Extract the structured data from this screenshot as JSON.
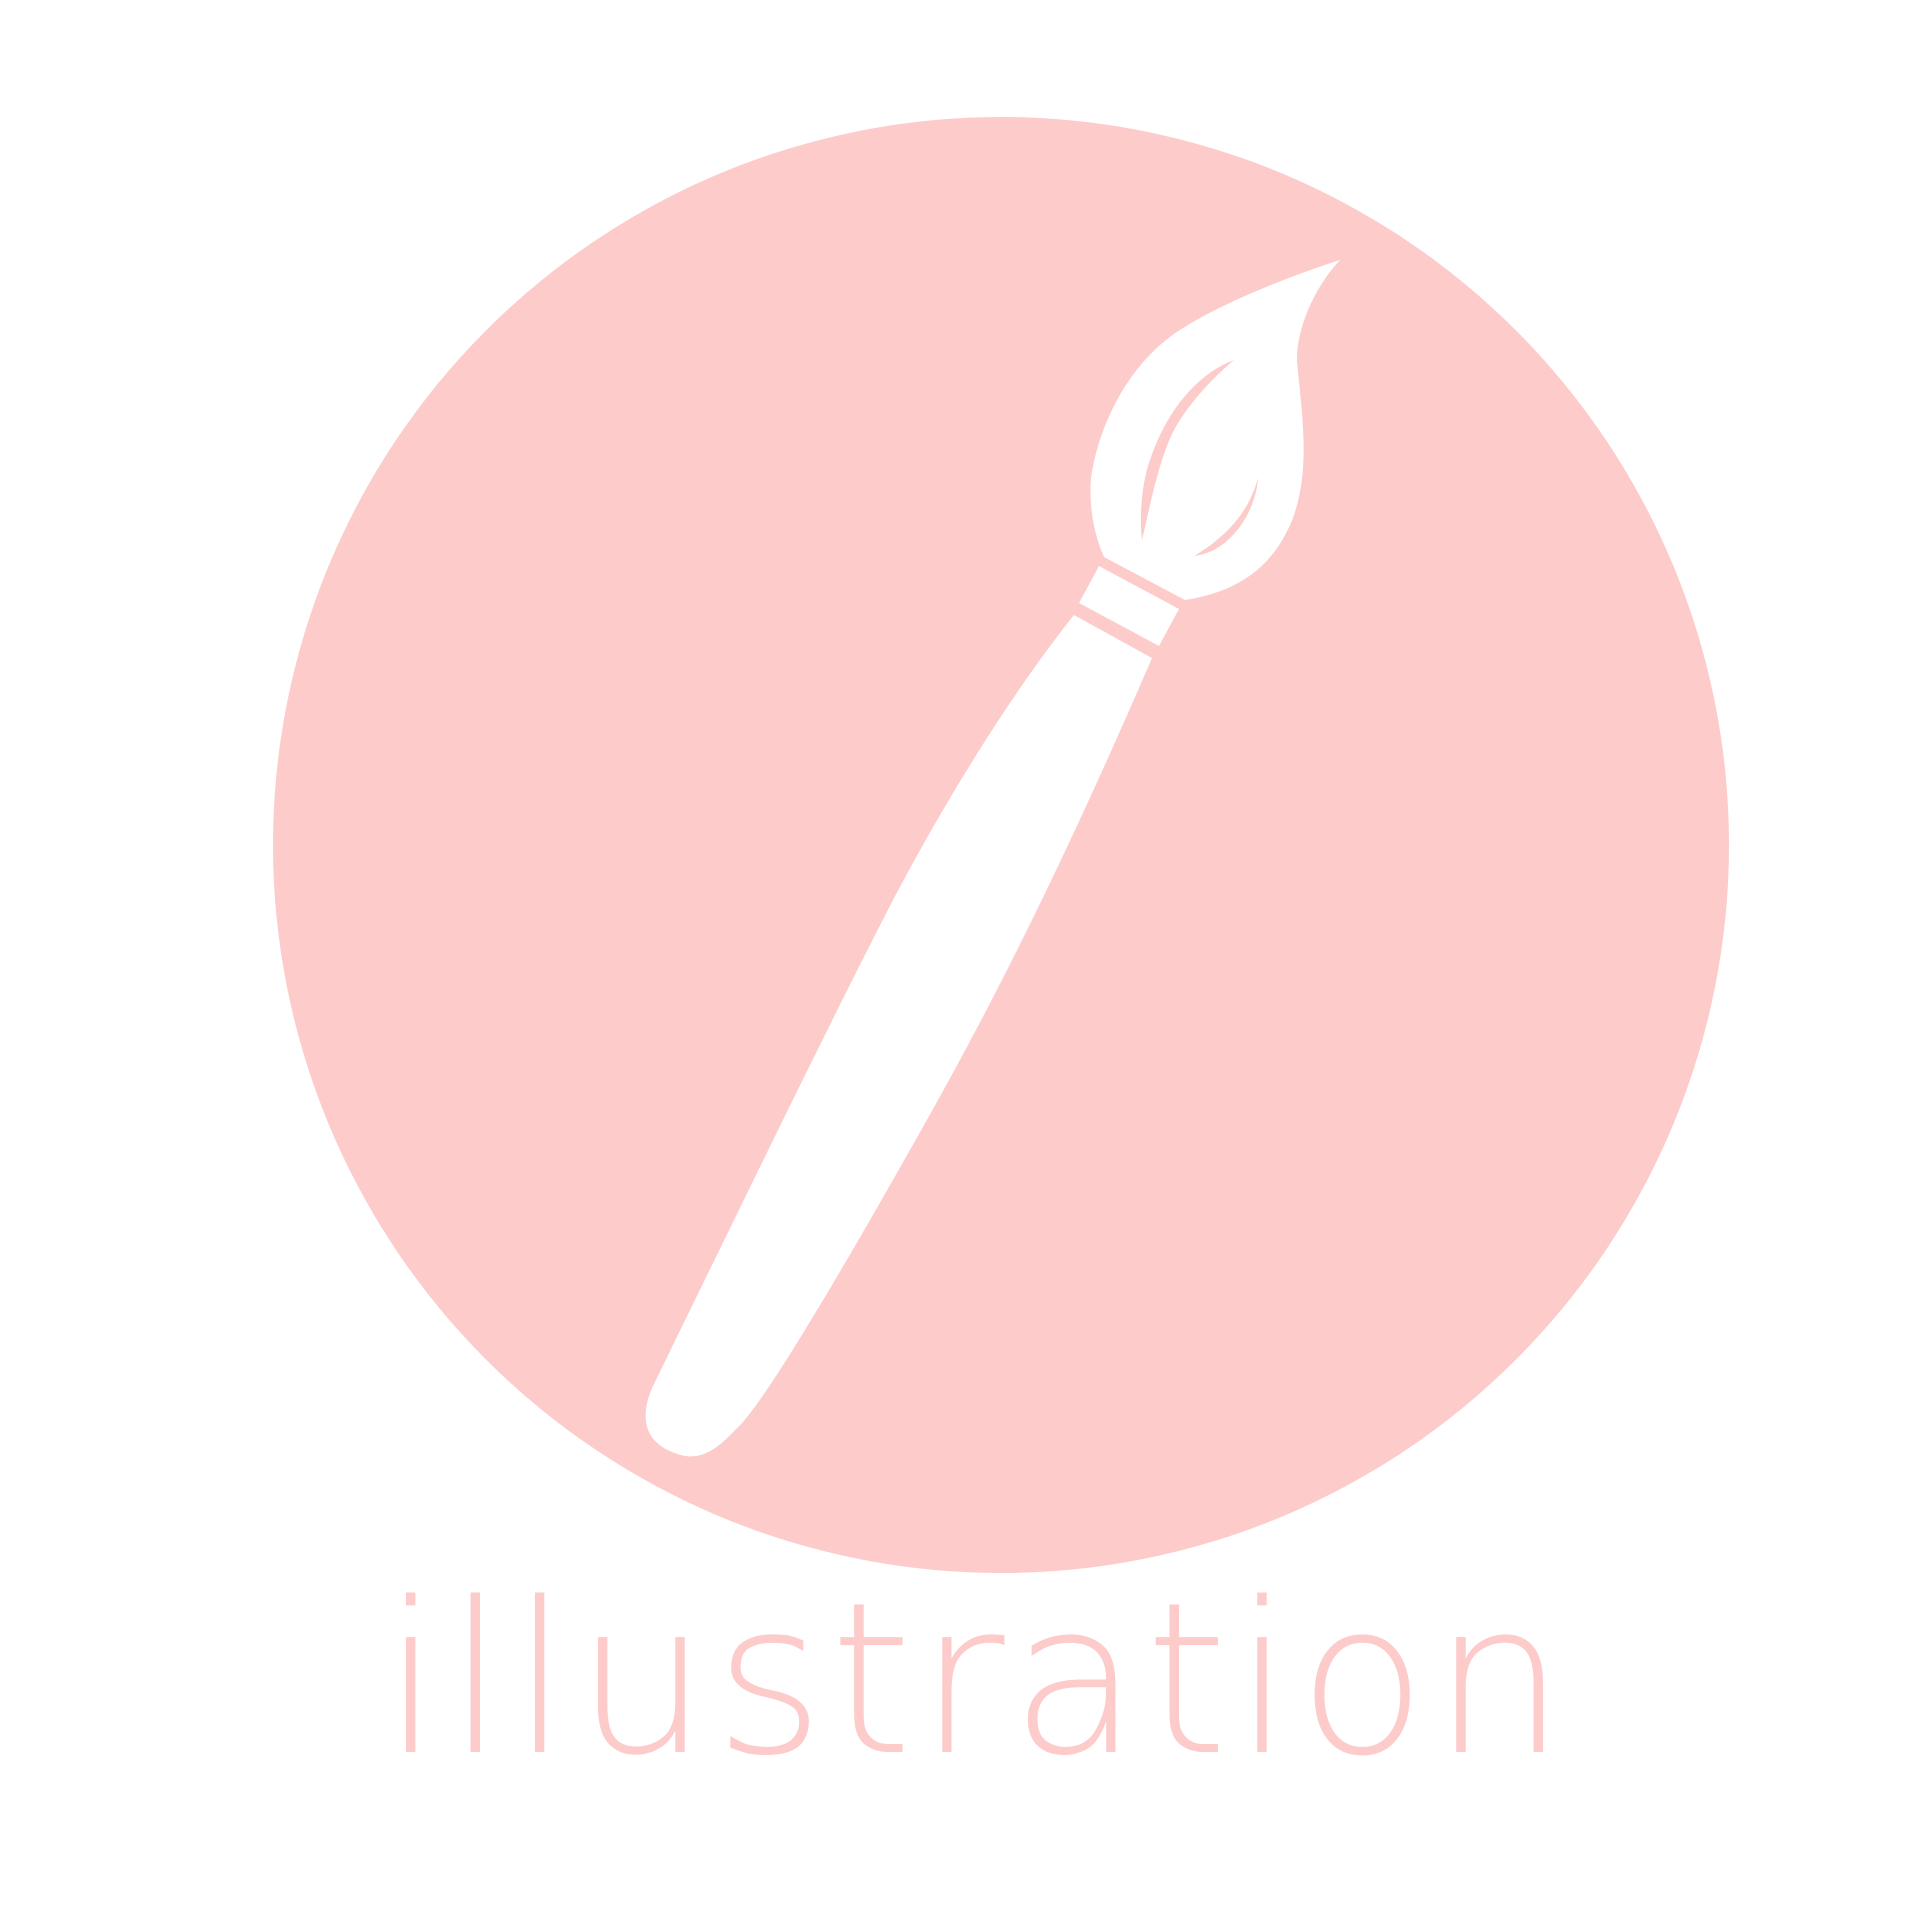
{
  "label": "illustration",
  "icon": "paintbrush-icon",
  "colors": {
    "accent": "#FCCBCA",
    "background": "#FFFFFF",
    "brush": "#FFFFFF"
  }
}
